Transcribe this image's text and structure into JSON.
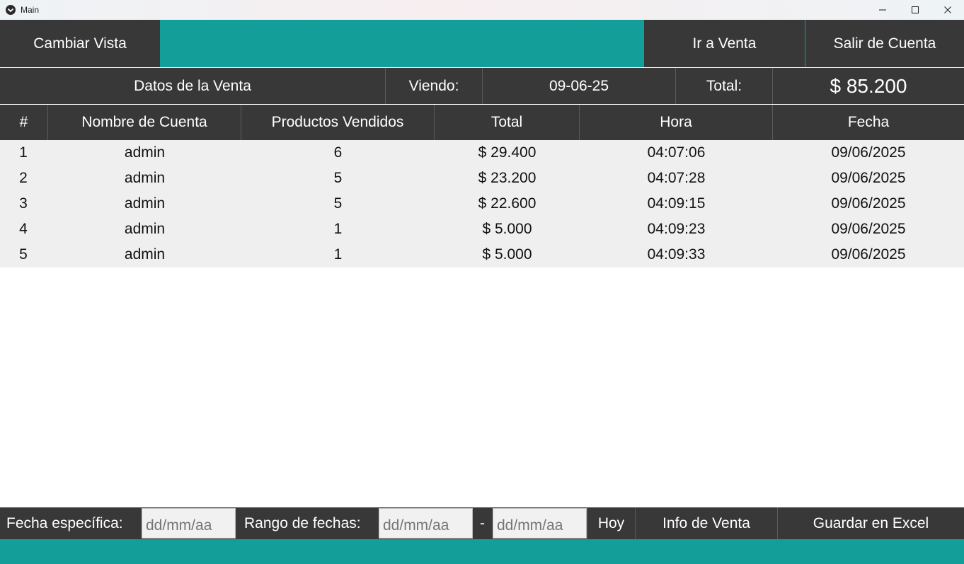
{
  "window": {
    "title": "Main"
  },
  "topbar": {
    "change_view": "Cambiar Vista",
    "go_to_sale": "Ir a Venta",
    "logout": "Salir de Cuenta"
  },
  "info": {
    "sale_data": "Datos de la Venta",
    "viewing_label": "Viendo:",
    "viewing_value": "09-06-25",
    "total_label": "Total:",
    "total_value": "$ 85.200"
  },
  "table": {
    "headers": [
      "#",
      "Nombre de Cuenta",
      "Productos Vendidos",
      "Total",
      "Hora",
      "Fecha"
    ],
    "rows": [
      [
        "1",
        "admin",
        "6",
        "$ 29.400",
        "04:07:06",
        "09/06/2025"
      ],
      [
        "2",
        "admin",
        "5",
        "$ 23.200",
        "04:07:28",
        "09/06/2025"
      ],
      [
        "3",
        "admin",
        "5",
        "$ 22.600",
        "04:09:15",
        "09/06/2025"
      ],
      [
        "4",
        "admin",
        "1",
        "$ 5.000",
        "04:09:23",
        "09/06/2025"
      ],
      [
        "5",
        "admin",
        "1",
        "$ 5.000",
        "04:09:33",
        "09/06/2025"
      ]
    ]
  },
  "bottom": {
    "specific_date_label": "Fecha específica:",
    "specific_date_placeholder": "dd/mm/aa",
    "range_label": "Rango de fechas:",
    "range_from_placeholder": "dd/mm/aa",
    "range_sep": "-",
    "range_to_placeholder": "dd/mm/aa",
    "today": "Hoy",
    "sale_info": "Info de Venta",
    "save_excel": "Guardar en Excel"
  },
  "colors": {
    "accent": "#149e9a",
    "dark": "#383838",
    "table_bg": "#efefef"
  },
  "icons": [
    "app-icon",
    "minimize-icon",
    "maximize-icon",
    "close-icon"
  ]
}
